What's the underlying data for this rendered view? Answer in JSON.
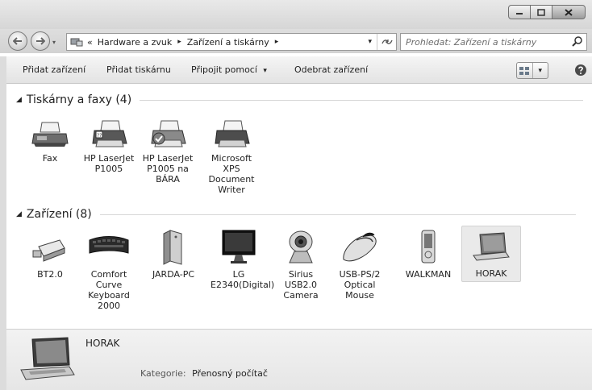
{
  "address": {
    "crumb_prefix": "«",
    "crumbs": [
      "Hardware a zvuk",
      "Zařízení a tiskárny"
    ],
    "sep": "▸",
    "dropdown": "▾"
  },
  "search": {
    "placeholder": "Prohledat: Zařízení a tiskárny"
  },
  "toolbar": {
    "add_device": "Přidat zařízení",
    "add_printer": "Přidat tiskárnu",
    "connect_using": "Připojit pomocí",
    "connect_arrow": "▾",
    "remove_device": "Odebrat zařízení",
    "view_arrow": "▾"
  },
  "groups": {
    "printers": {
      "title": "Tiskárny a faxy (4)",
      "arrow": "◢"
    },
    "devices": {
      "title": "Zařízení (8)",
      "arrow": "◢"
    }
  },
  "printers": [
    {
      "label": "Fax",
      "icon": "fax-icon"
    },
    {
      "label": "HP LaserJet P1005",
      "icon": "printer-icon"
    },
    {
      "label": "HP LaserJet P1005 na BÁRA",
      "icon": "printer-default-icon"
    },
    {
      "label": "Microsoft XPS Document Writer",
      "icon": "printer-icon"
    }
  ],
  "devices": [
    {
      "label": "BT2.0",
      "icon": "bluetooth-dongle-icon"
    },
    {
      "label": "Comfort Curve Keyboard 2000",
      "icon": "keyboard-icon"
    },
    {
      "label": "JARDA-PC",
      "icon": "computer-tower-icon"
    },
    {
      "label": "LG E2340(Digital)",
      "icon": "monitor-icon"
    },
    {
      "label": "Sirius USB2.0 Camera",
      "icon": "webcam-icon"
    },
    {
      "label": "USB-PS/2 Optical Mouse",
      "icon": "mouse-icon"
    },
    {
      "label": "WALKMAN",
      "icon": "media-player-icon"
    },
    {
      "label": "HORAK",
      "icon": "laptop-icon"
    }
  ],
  "details": {
    "name": "HORAK",
    "category_label": "Kategorie:",
    "category_value": "Přenosný počítač"
  }
}
